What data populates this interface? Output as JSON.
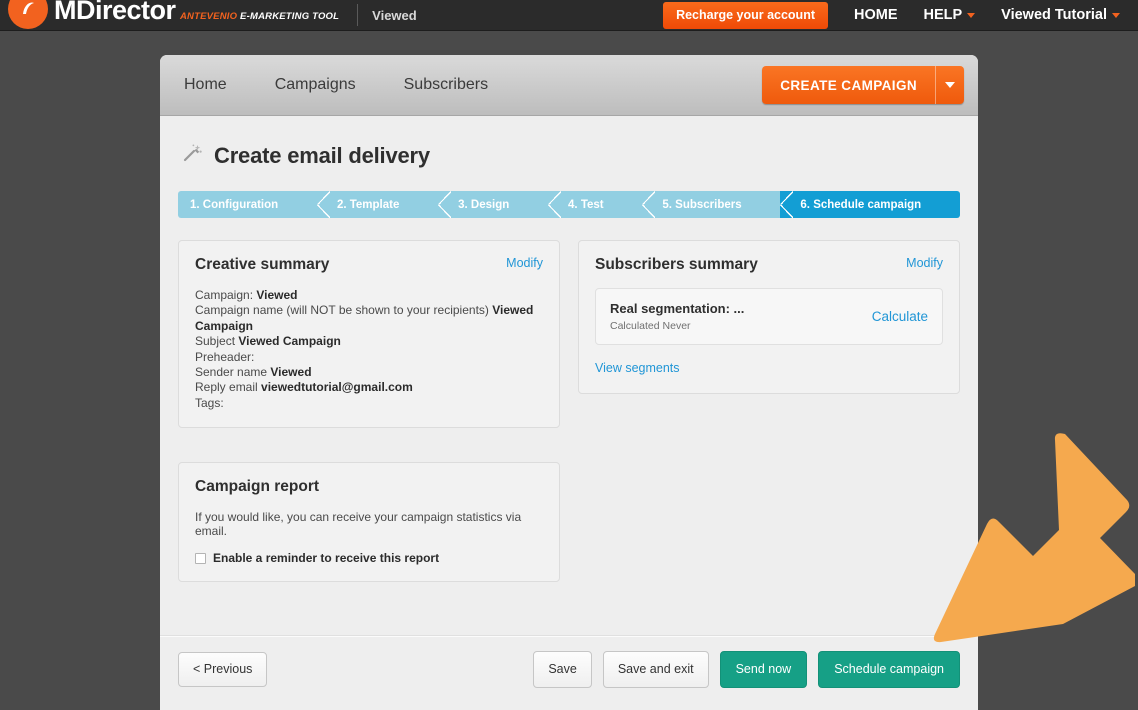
{
  "topbar": {
    "logo_name": "MDirector",
    "logo_tagline_accent": "ANTEVENIO",
    "logo_tagline_rest": " E-MARKETING TOOL",
    "account_name": "Viewed",
    "recharge_label": "Recharge your account",
    "nav": [
      {
        "label": "HOME",
        "has_caret": false
      },
      {
        "label": "HELP",
        "has_caret": true
      },
      {
        "label": "Viewed Tutorial",
        "has_caret": true
      }
    ]
  },
  "toolbar": {
    "tabs": [
      {
        "label": "Home"
      },
      {
        "label": "Campaigns"
      },
      {
        "label": "Subscribers"
      }
    ],
    "create_campaign_label": "CREATE CAMPAIGN"
  },
  "page": {
    "title": "Create email delivery",
    "steps": [
      {
        "label": "1. Configuration",
        "active": false
      },
      {
        "label": "2. Template",
        "active": false
      },
      {
        "label": "3. Design",
        "active": false
      },
      {
        "label": "4. Test",
        "active": false
      },
      {
        "label": "5. Subscribers",
        "active": false
      },
      {
        "label": "6. Schedule campaign",
        "active": true
      }
    ]
  },
  "creative_summary": {
    "title": "Creative summary",
    "modify_label": "Modify",
    "rows": [
      {
        "label": "Campaign:",
        "value": "Viewed"
      },
      {
        "label": "Campaign name (will NOT be shown to your recipients)",
        "value": "Viewed Campaign"
      },
      {
        "label": "Subject",
        "value": "Viewed Campaign"
      },
      {
        "label": "Preheader:",
        "value": ""
      },
      {
        "label": "Sender name",
        "value": "Viewed"
      },
      {
        "label": "Reply email",
        "value": "viewedtutorial@gmail.com"
      },
      {
        "label": "Tags:",
        "value": ""
      }
    ]
  },
  "subscribers_summary": {
    "title": "Subscribers summary",
    "modify_label": "Modify",
    "segment_title": "Real segmentation: ...",
    "segment_sub": "Calculated  Never",
    "calculate_label": "Calculate",
    "view_segments_label": "View segments"
  },
  "campaign_report": {
    "title": "Campaign report",
    "description": "If you would like, you can receive your campaign statistics via email.",
    "checkbox_label": "Enable a reminder to receive this report",
    "checked": false
  },
  "footer": {
    "previous_label": "< Previous",
    "save_label": "Save",
    "save_exit_label": "Save and exit",
    "send_now_label": "Send now",
    "schedule_label": "Schedule campaign"
  },
  "colors": {
    "brand_orange": "#f2621f",
    "step_active_blue": "#139ed4",
    "step_blue": "#92cfe2",
    "green": "#16a086",
    "link_blue": "#2196d6",
    "annotation_orange": "#f5a94e",
    "page_background": "#4a4a4a"
  }
}
